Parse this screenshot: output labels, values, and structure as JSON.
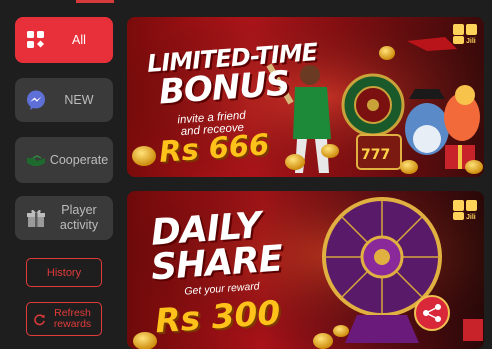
{
  "sidebar": {
    "categories": [
      {
        "label": "All",
        "icon": "grid-icon",
        "active": true
      },
      {
        "label": "NEW",
        "icon": "messenger-icon",
        "active": false
      },
      {
        "label": "Cooperate",
        "icon": "handshake-icon",
        "active": false
      },
      {
        "label": "Player activity",
        "icon": "gift-icon",
        "active": false
      }
    ],
    "history_label": "History",
    "refresh_label": "Refresh rewards"
  },
  "banners": [
    {
      "headline_line1": "LIMITED-TIME",
      "headline_line2": "BONUS",
      "sub_line1": "invite a friend",
      "sub_line2": "and receove",
      "reward": "Rs 666",
      "logo_text": "Jili"
    },
    {
      "headline_line1": "DAILY",
      "headline_line2": "SHARE",
      "sub": "Get your reward",
      "reward": "Rs 300",
      "logo_text": "Jili"
    }
  ],
  "colors": {
    "accent": "#e8303a",
    "background": "#1e1e1e",
    "category_bg": "#3a3a3a",
    "reward_gold": "#ffc21a"
  }
}
